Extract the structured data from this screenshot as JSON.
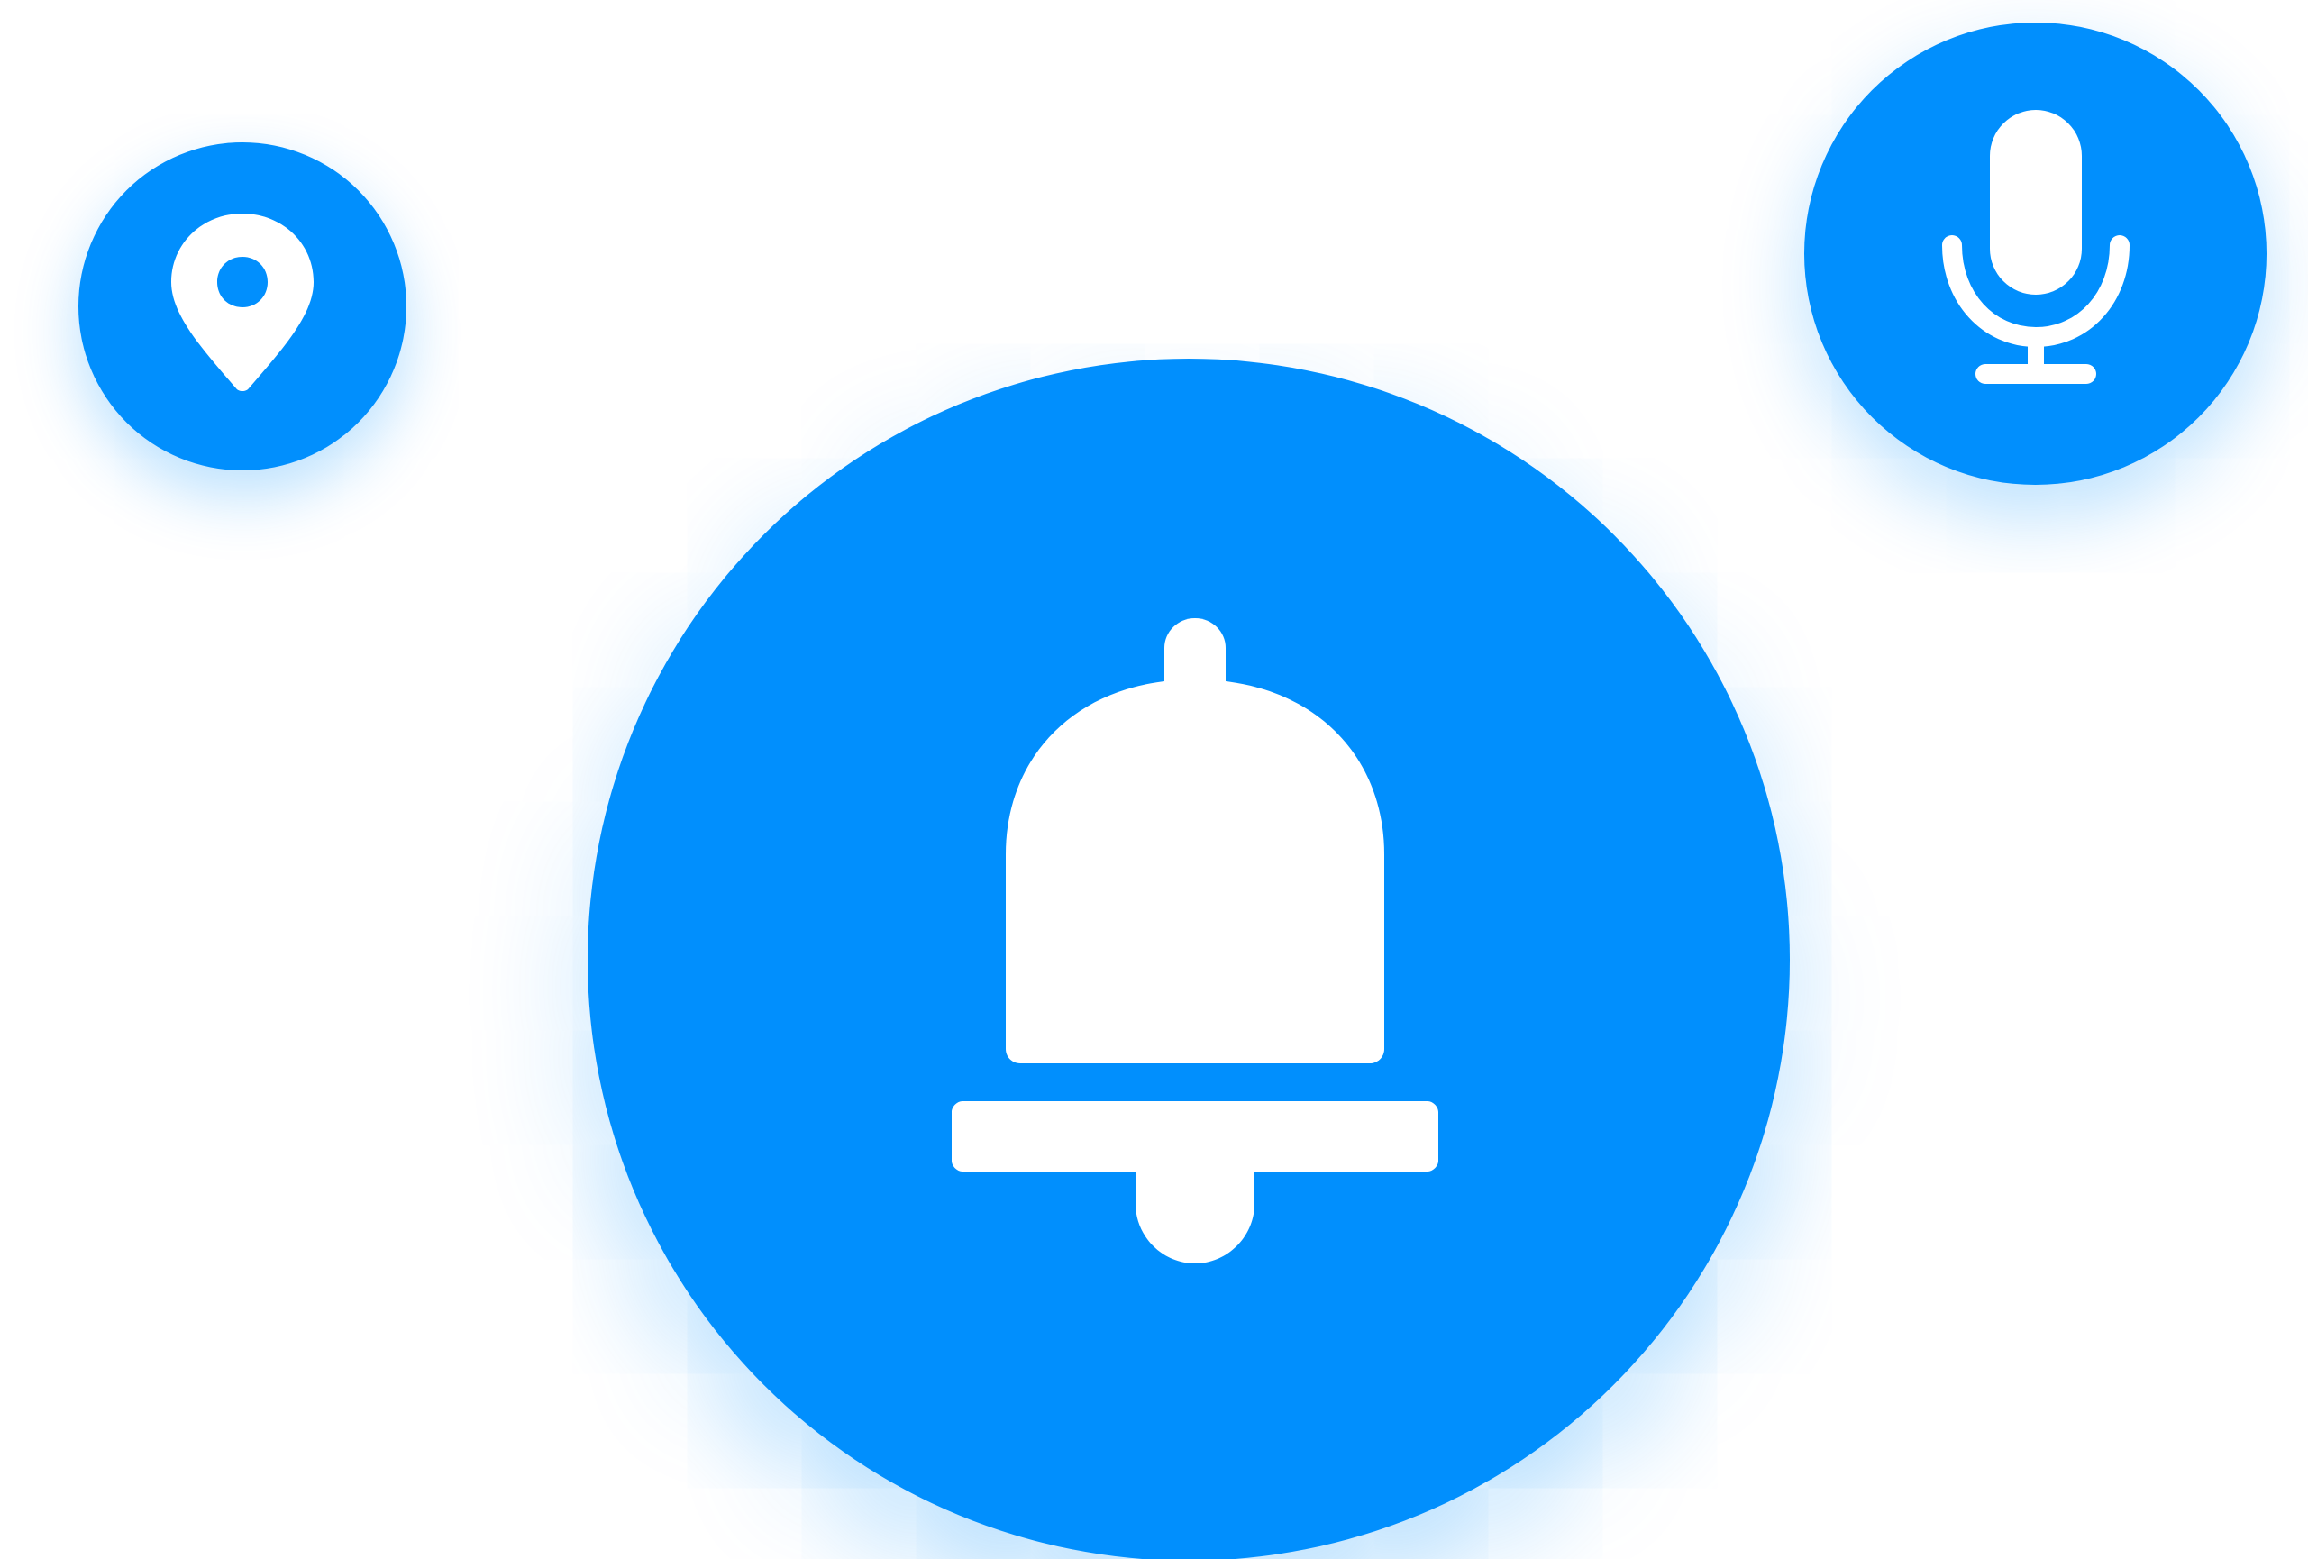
{
  "buttons": {
    "location": {
      "icon": "location-pin-icon"
    },
    "microphone": {
      "icon": "microphone-icon"
    },
    "notification": {
      "icon": "bell-icon"
    }
  },
  "colors": {
    "accent": "#018ffd",
    "icon": "#ffffff",
    "background": "#ffffff"
  }
}
